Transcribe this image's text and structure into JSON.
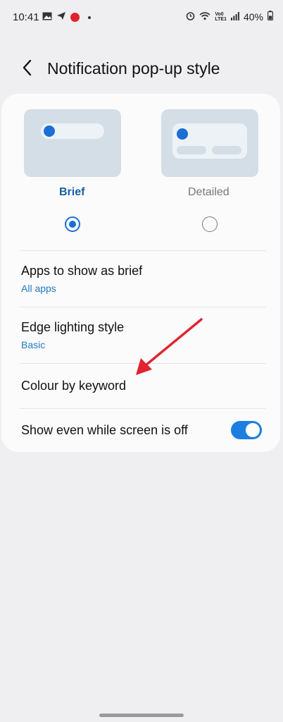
{
  "status_bar": {
    "time": "10:41",
    "left_icons": [
      "gallery-icon",
      "send-icon",
      "app-red-icon"
    ],
    "right_icons": [
      "alarm-icon",
      "wifi-icon",
      "volte-icon",
      "signal-icon"
    ],
    "volte_text": "Vo0\nLTE1",
    "battery": "40%"
  },
  "header": {
    "title": "Notification pop-up style"
  },
  "styles": {
    "options": [
      {
        "label": "Brief",
        "selected": true
      },
      {
        "label": "Detailed",
        "selected": false
      }
    ],
    "accent": "#1b6ed6"
  },
  "settings": {
    "apps_title": "Apps to show as brief",
    "apps_value": "All apps",
    "edge_title": "Edge lighting style",
    "edge_value": "Basic",
    "colour_title": "Colour by keyword",
    "screen_off_title": "Show even while screen is off",
    "screen_off_enabled": true
  },
  "annotation": {
    "color": "#e0242f"
  }
}
